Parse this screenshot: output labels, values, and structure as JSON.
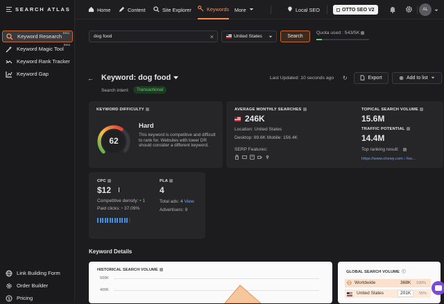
{
  "brand": {
    "name": "SEARCH ATLAS"
  },
  "sidebar": {
    "items": [
      {
        "label": "Keyword Research",
        "badge": "Beta",
        "icon": "search-icon"
      },
      {
        "label": "Keyword Magic Tool",
        "badge": "Beta",
        "icon": "wand-icon"
      },
      {
        "label": "Keyword Rank Tracker",
        "icon": "rank-icon"
      },
      {
        "label": "Keyword Gap",
        "icon": "chart-icon"
      }
    ],
    "bottom": [
      {
        "label": "Link Building Form",
        "icon": "globe-icon"
      },
      {
        "label": "Order Builder",
        "icon": "gear-icon"
      },
      {
        "label": "Pricing",
        "icon": "dollar-icon"
      }
    ]
  },
  "nav": {
    "home": "Home",
    "content": "Content",
    "site_explorer": "Site Explorer",
    "keywords": "Keywords",
    "more": "More",
    "local_seo": "Local SEO",
    "otto": "OTTO SEO V2",
    "avatar": "AL"
  },
  "search": {
    "query": "dog food",
    "country": "United States",
    "button": "Search",
    "quota": "Quota used : 543/5K",
    "quota_fraction": 0.11
  },
  "keyword": {
    "title": "Keyword: dog food",
    "intent_label": "Search intent:",
    "intent": "Transactional",
    "updated": "Last Updated: 10 seconds ago",
    "export": "Export",
    "add_to_list": "Add to list"
  },
  "difficulty": {
    "label": "KEYWORD DIFFICULTY",
    "value": "62",
    "level": "Hard",
    "desc": "This keyword is competitive and difficult to rank for. Websites with lower DR should consider a different keyword.",
    "fraction": 0.62
  },
  "monthly": {
    "label": "AVERAGE MONTHLY SEARCHES",
    "value": "246K",
    "location": "Location: United States",
    "devices": "Desktop: 89.6K   Mobile: 156.4K",
    "serp": "SERP Features:"
  },
  "topical": {
    "label": "TOPICAL SEARCH VOLUME",
    "value": "15.6M",
    "traffic_label": "TRAFFIC POTENTIAL",
    "traffic_value": "14.4M",
    "top_label": "Top ranking result:",
    "top_url": "https://www.chewy.com › foo..."
  },
  "cpc": {
    "label": "CPC",
    "value": "$12",
    "density": "Competitive density: ",
    "density_value": "1",
    "paid": "Paid clicks: ",
    "paid_value": "37.09%",
    "density_fraction": 0.9
  },
  "pla": {
    "label": "PLA",
    "value": "4",
    "ads": "Total ads: 4 ",
    "view": "View",
    "advertisers": "Advertisers: 9"
  },
  "details": {
    "title": "Keyword Details",
    "hist_label": "HISTORICAL SEARCH VOLUME",
    "y_ticks": [
      "500K",
      "400K"
    ],
    "global_label": "GLOBAL SEARCH VOLUME",
    "rows": [
      {
        "name": "Worldwide",
        "value": "368K",
        "pct": "100%"
      },
      {
        "name": "United States",
        "value": "201K",
        "pct": "55%"
      }
    ]
  },
  "colors": {
    "accent": "#ff8a4c",
    "green": "#5fd36d",
    "link": "#6aa8ff",
    "bar": "#4a90e2"
  }
}
